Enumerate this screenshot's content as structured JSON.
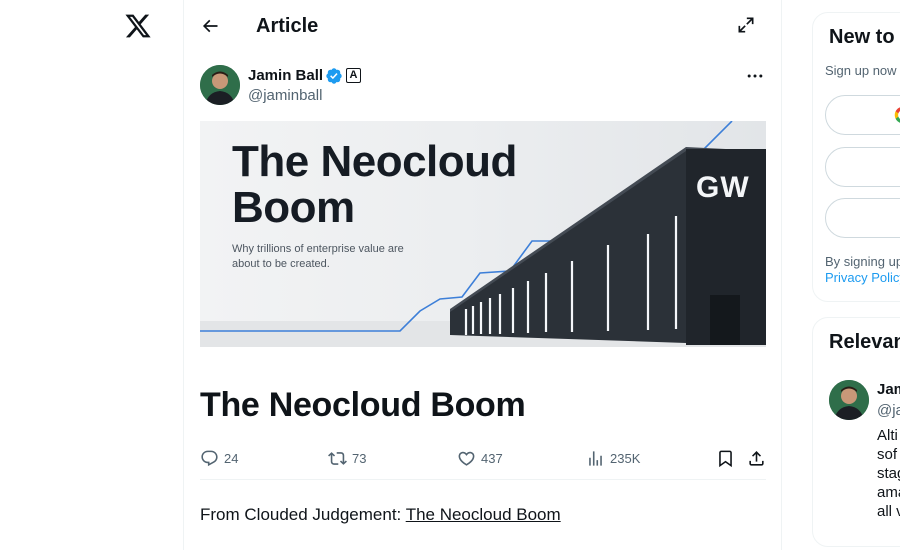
{
  "colors": {
    "accent": "#1d9bf0",
    "text": "#0f1419",
    "muted": "#536471",
    "border": "#eff3f4"
  },
  "nav": {
    "logo_icon": "x-logo-icon"
  },
  "header": {
    "title": "Article",
    "back_icon": "arrow-left-icon",
    "expand_icon": "expand-icon"
  },
  "author": {
    "name": "Jamin Ball",
    "handle": "@jaminball",
    "verified_icon": "verified-badge-icon",
    "affiliation_badge": "A"
  },
  "banner": {
    "title": "The Neocloud Boom",
    "subtitle": "Why trillions of enterprise value are about to be created.",
    "building_sign": "GW"
  },
  "article": {
    "title": "The Neocloud Boom",
    "body_prefix": "From Clouded Judgement: ",
    "body_link": "The Neocloud Boom"
  },
  "actions": {
    "replies": "24",
    "reposts": "73",
    "likes": "437",
    "views": "235K"
  },
  "sidebar": {
    "signup": {
      "title": "New to",
      "subtitle": "Sign up now",
      "terms_prefix": "By signing up",
      "terms_link": "Privacy Policy"
    },
    "relevant": {
      "title": "Relevant",
      "name": "Jam",
      "handle": "@ja",
      "bio": "Alti\nsof\nstag\nama\nall v"
    }
  }
}
